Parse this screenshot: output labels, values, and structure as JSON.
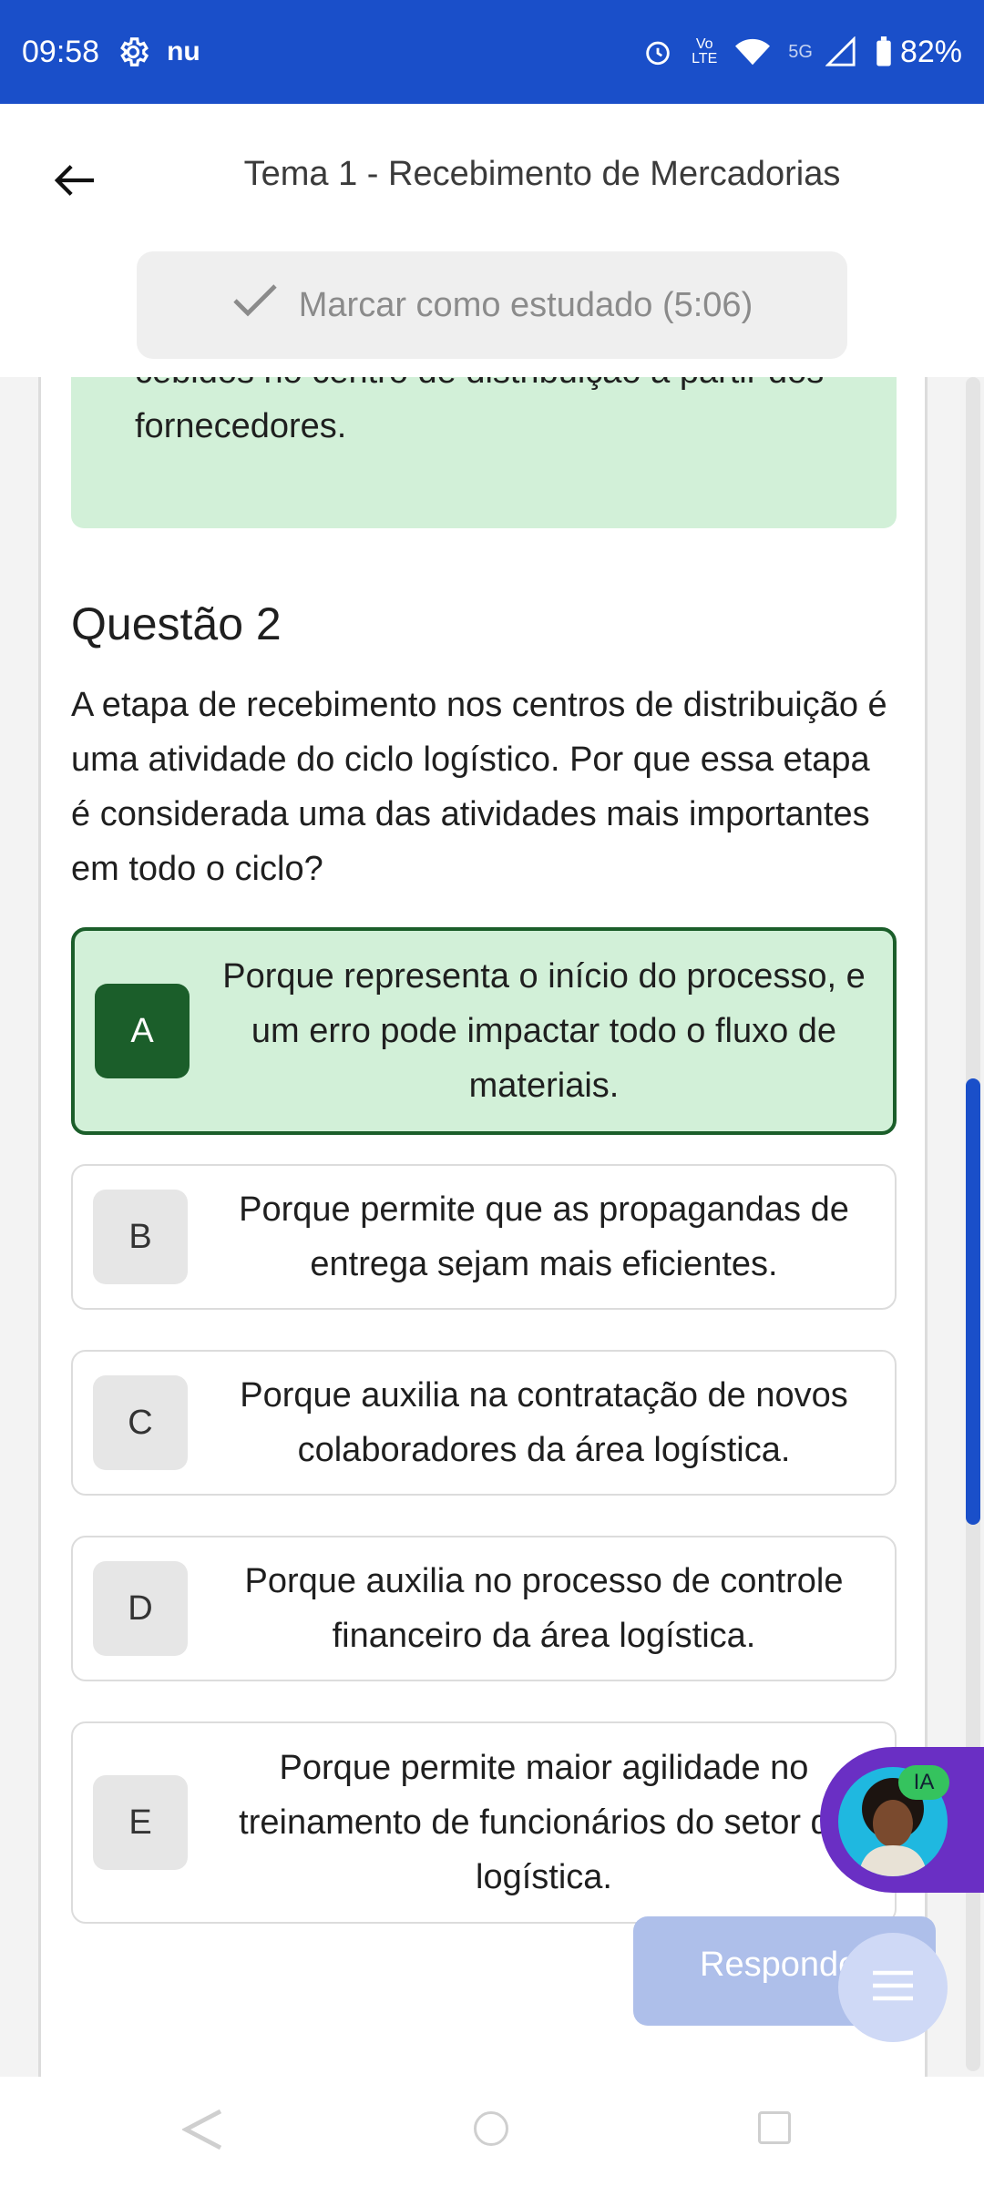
{
  "status_bar": {
    "time": "09:58",
    "battery": "82%",
    "network_label": "5G",
    "volte_label": "VoLTE",
    "icons": [
      "settings-gear-icon",
      "nu-app-icon",
      "alarm-icon",
      "volte-icon",
      "wifi-icon",
      "signal-icon",
      "battery-icon"
    ]
  },
  "header": {
    "title": "Tema 1 - Recebimento de Mercadorias",
    "mark_studied_label": "Marcar como estudado (5:06)"
  },
  "feedback": {
    "text": "cebidos no centro de distribuição a partir dos fornecedores."
  },
  "question": {
    "title": "Questão 2",
    "text": "A etapa de recebimento nos centros de distribuição é uma atividade do ciclo logístico. Por que essa etapa é considerada uma das atividades mais importantes em todo o ciclo?",
    "options": [
      {
        "letter": "A",
        "text": "Porque representa o início do processo, e um erro pode impactar todo o fluxo de materiais.",
        "selected": true
      },
      {
        "letter": "B",
        "text": "Porque permite que as propagandas de entrega sejam mais eficientes.",
        "selected": false
      },
      {
        "letter": "C",
        "text": "Porque auxilia na contratação de novos colaboradores da área logística.",
        "selected": false
      },
      {
        "letter": "D",
        "text": "Porque auxilia no processo de controle financeiro da área logística.",
        "selected": false
      },
      {
        "letter": "E",
        "text": "Porque permite maior agilidade no treinamento de funcionários do setor de logística.",
        "selected": false
      }
    ]
  },
  "responder_label": "Responder",
  "ai_badge": "IA",
  "colors": {
    "brand_blue": "#1a4fc9",
    "selected_green": "#1b5e2a",
    "selected_bg": "#d2f0d8",
    "ai_purple": "#6a2fc4"
  }
}
